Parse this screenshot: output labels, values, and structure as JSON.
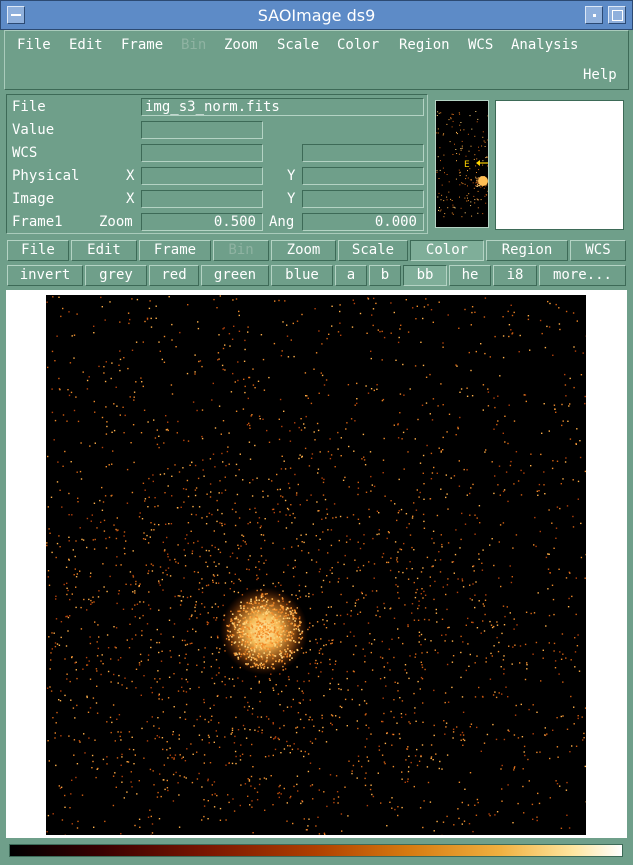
{
  "window": {
    "title": "SAOImage ds9"
  },
  "menu": {
    "items": [
      {
        "label": "File",
        "enabled": true
      },
      {
        "label": "Edit",
        "enabled": true
      },
      {
        "label": "Frame",
        "enabled": true
      },
      {
        "label": "Bin",
        "enabled": false
      },
      {
        "label": "Zoom",
        "enabled": true
      },
      {
        "label": "Scale",
        "enabled": true
      },
      {
        "label": "Color",
        "enabled": true
      },
      {
        "label": "Region",
        "enabled": true
      },
      {
        "label": "WCS",
        "enabled": true
      },
      {
        "label": "Analysis",
        "enabled": true
      }
    ],
    "help": "Help"
  },
  "info": {
    "file_label": "File",
    "file_value": "img_s3_norm.fits",
    "value_label": "Value",
    "value": "",
    "wcs_label": "WCS",
    "wcs_value_1": "",
    "wcs_value_2": "",
    "physical_label": "Physical",
    "physical_x_label": "X",
    "physical_y_label": "Y",
    "physical_x": "",
    "physical_y": "",
    "image_label": "Image",
    "image_x_label": "X",
    "image_y_label": "Y",
    "image_x": "",
    "image_y": "",
    "frame_label": "Frame1",
    "zoom_label": "Zoom",
    "zoom_value": "0.500",
    "angle_label": "Ang",
    "angle_value": "0.000"
  },
  "panner": {
    "compass_label": "E"
  },
  "buttonbar": {
    "items": [
      {
        "label": "File",
        "selected": false,
        "enabled": true
      },
      {
        "label": "Edit",
        "selected": false,
        "enabled": true
      },
      {
        "label": "Frame",
        "selected": false,
        "enabled": true
      },
      {
        "label": "Bin",
        "selected": false,
        "enabled": false
      },
      {
        "label": "Zoom",
        "selected": false,
        "enabled": true
      },
      {
        "label": "Scale",
        "selected": false,
        "enabled": true
      },
      {
        "label": "Color",
        "selected": true,
        "enabled": true
      },
      {
        "label": "Region",
        "selected": false,
        "enabled": true
      },
      {
        "label": "WCS",
        "selected": false,
        "enabled": true
      }
    ]
  },
  "colorbar_buttons": {
    "items": [
      {
        "label": "invert",
        "selected": false
      },
      {
        "label": "grey",
        "selected": false
      },
      {
        "label": "red",
        "selected": false
      },
      {
        "label": "green",
        "selected": false
      },
      {
        "label": "blue",
        "selected": false
      },
      {
        "label": "a",
        "selected": false
      },
      {
        "label": "b",
        "selected": false
      },
      {
        "label": "bb",
        "selected": true
      },
      {
        "label": "he",
        "selected": false
      },
      {
        "label": "i8",
        "selected": false
      },
      {
        "label": "more...",
        "selected": false
      }
    ]
  },
  "colors": {
    "chrome": "#6f9f8a",
    "titlebar": "#5d8bc7",
    "image_background": "#000000",
    "colormap": "bb"
  }
}
